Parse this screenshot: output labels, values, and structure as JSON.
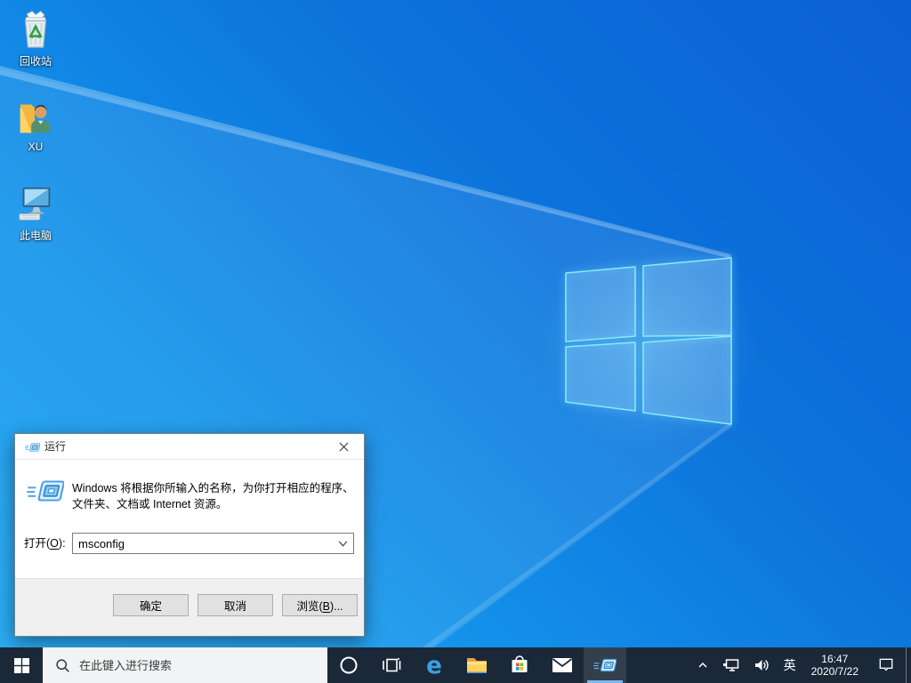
{
  "desktop": {
    "icons": [
      {
        "label": "回收站",
        "icon": "recycle-bin-icon"
      },
      {
        "label": "XU",
        "icon": "user-folder-icon"
      },
      {
        "label": "此电脑",
        "icon": "this-pc-icon"
      }
    ]
  },
  "run_dialog": {
    "title": "运行",
    "icon": "run-icon",
    "description_line1": "Windows 将根据你所输入的名称，为你打开相应的程序、",
    "description_line2": "文件夹、文档或 Internet 资源。",
    "open_label": {
      "prefix": "打开(",
      "mnemonic": "O",
      "suffix": "):"
    },
    "input_value": "msconfig",
    "buttons": {
      "ok": "确定",
      "cancel": "取消",
      "browse": {
        "prefix": "浏览(",
        "mnemonic": "B",
        "suffix": ")..."
      }
    }
  },
  "taskbar": {
    "search_placeholder": "在此键入进行搜索",
    "apps": [
      {
        "icon": "cortana-icon",
        "active": false
      },
      {
        "icon": "task-view-icon",
        "active": false
      },
      {
        "icon": "edge-icon",
        "active": false
      },
      {
        "icon": "file-explorer-icon",
        "active": false
      },
      {
        "icon": "store-icon",
        "active": false
      },
      {
        "icon": "mail-icon",
        "active": false
      },
      {
        "icon": "run-icon",
        "active": true
      }
    ],
    "tray": {
      "hidden_icons": "chevron-up-icon",
      "network": "network-icon",
      "volume": "volume-icon",
      "ime": "英",
      "time": "16:47",
      "date": "2020/7/22",
      "action_center": "action-center-icon"
    }
  },
  "colors": {
    "accent": "#0078d7",
    "taskbar_bg": "#1b2838",
    "active_underline": "#76b9ed",
    "desktop_base": "#1193e9",
    "dialog_footer": "#f0f0f0",
    "button_face": "#e1e1e1"
  }
}
